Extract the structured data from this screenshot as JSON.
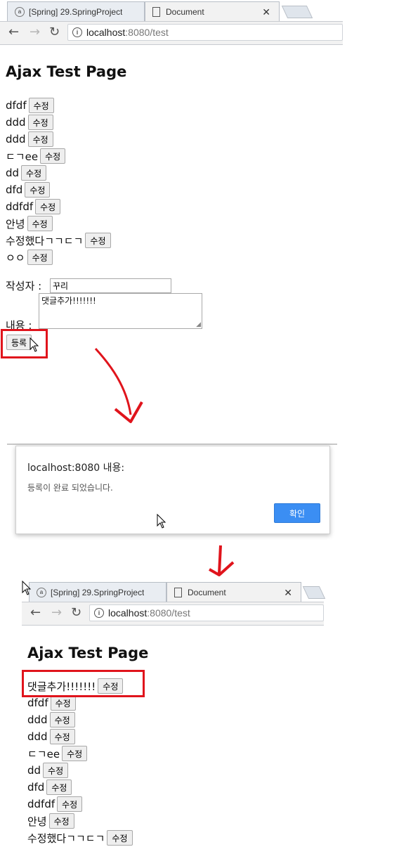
{
  "top_browser": {
    "tabs": [
      {
        "label": "[Spring] 29.SpringProject"
      },
      {
        "label": "Document"
      }
    ],
    "url_host": "localhost",
    "url_rest": ":8080/test"
  },
  "top_page": {
    "heading": "Ajax Test Page",
    "button_label": "수정",
    "comments": [
      "dfdf",
      "ddd",
      "ddd",
      "ㄷㄱee",
      "dd",
      "dfd",
      "ddfdf",
      "안녕",
      "수정했다ㄱㄱㄷㄱ",
      "ㅇㅇ"
    ],
    "form": {
      "writer_label": "작성자 :",
      "writer_value": "꾸리",
      "content_label": "내용 :",
      "content_value": "댓글추가!!!!!!!",
      "submit_label": "등록"
    }
  },
  "alert_dialog": {
    "title": "localhost:8080 내용:",
    "message": "등록이 완료 되었습니다.",
    "ok_label": "확인"
  },
  "bottom_browser": {
    "tabs": [
      {
        "label": "[Spring] 29.SpringProject"
      },
      {
        "label": "Document"
      }
    ],
    "url_host": "localhost",
    "url_rest": ":8080/test"
  },
  "bottom_page": {
    "heading": "Ajax Test Page",
    "button_label": "수정",
    "comments": [
      "댓글추가!!!!!!!",
      "dfdf",
      "ddd",
      "ddd",
      "ㄷㄱee",
      "dd",
      "dfd",
      "ddfdf",
      "안녕",
      "수정했다ㄱㄱㄷㄱ"
    ]
  },
  "colors": {
    "highlight_red": "#e0141c",
    "ok_button_blue": "#3b8ef3",
    "arrow_red": "#e0141c"
  }
}
